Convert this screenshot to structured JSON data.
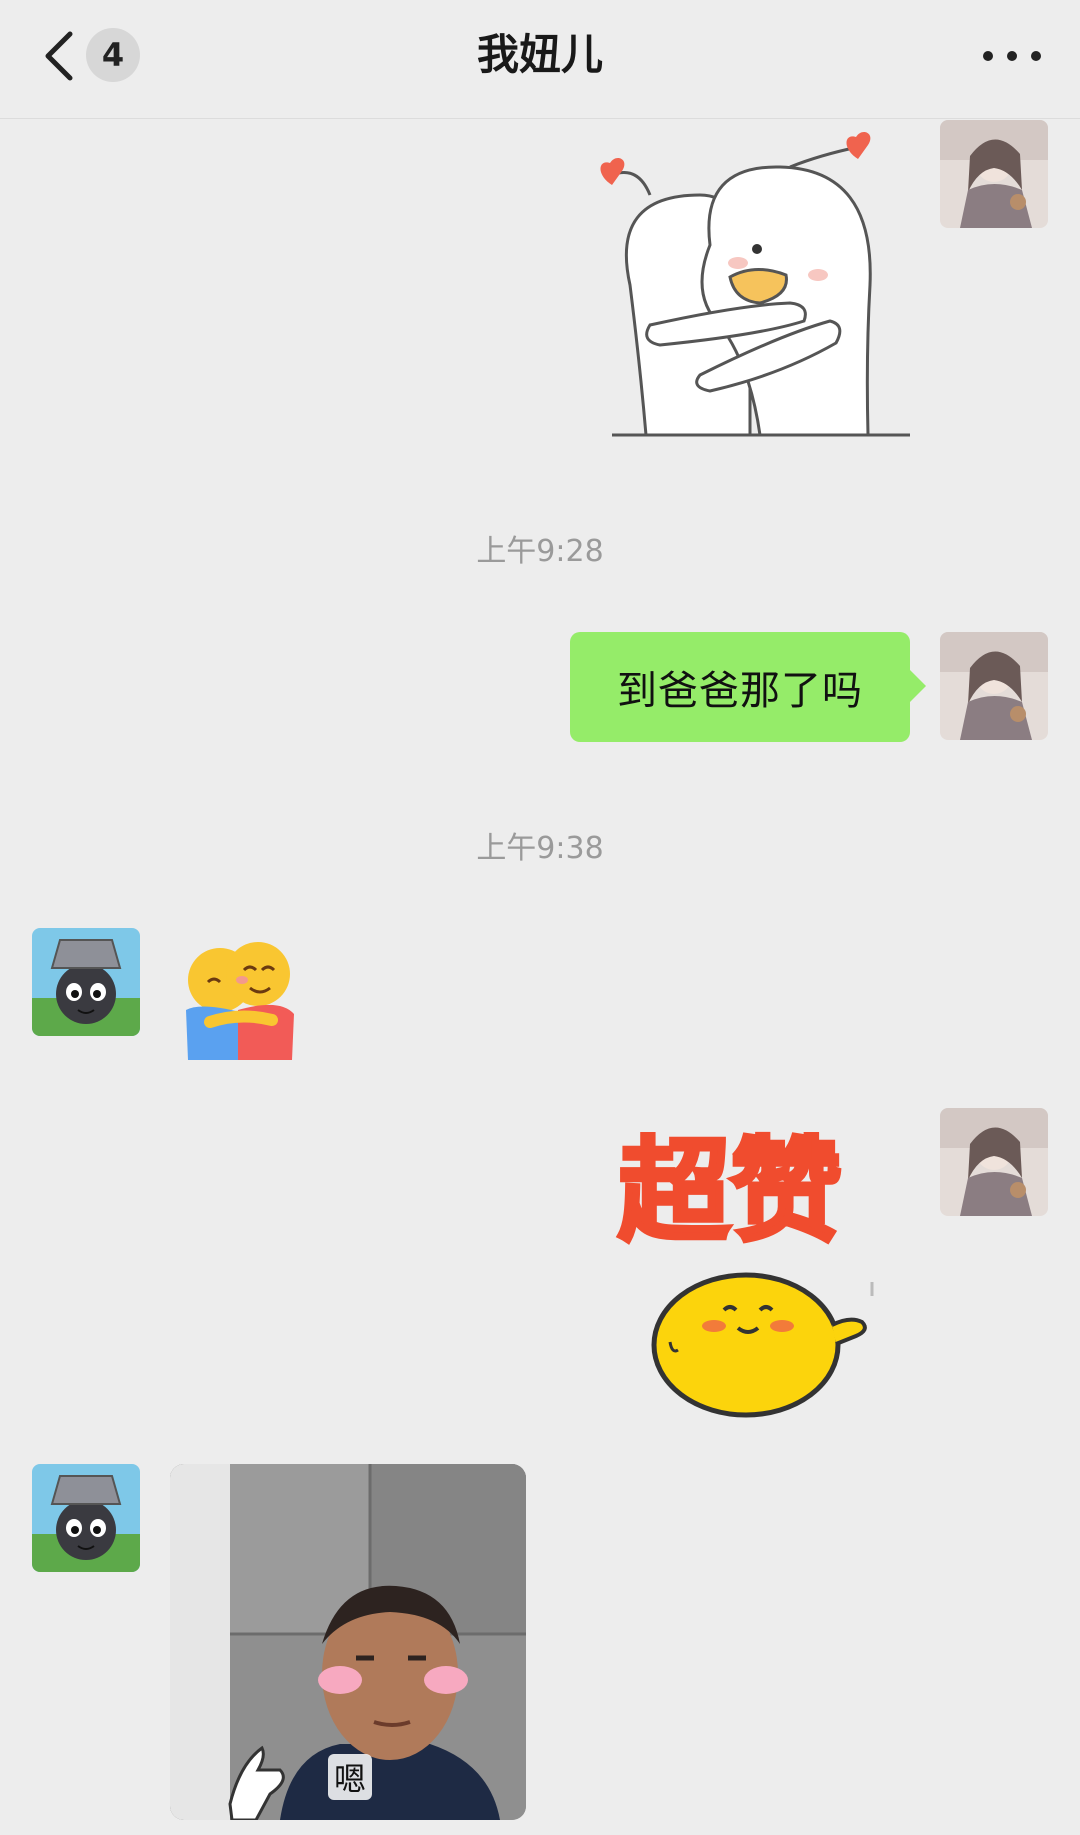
{
  "header": {
    "unread_count": "4",
    "title": "我妞儿",
    "icons": {
      "back": "chevron-left-icon",
      "more": "more-dots-icon"
    }
  },
  "messages": [
    {
      "sender": "me",
      "kind": "sticker",
      "sticker": "hugging-ducks-sticker"
    },
    {
      "kind": "timestamp",
      "text": "上午9:28"
    },
    {
      "sender": "me",
      "kind": "text",
      "text": "到爸爸那了吗"
    },
    {
      "kind": "timestamp",
      "text": "上午9:38"
    },
    {
      "sender": "other",
      "kind": "emoji",
      "emoji": "hug-emoji"
    },
    {
      "sender": "me",
      "kind": "sticker",
      "sticker": "super-like-sticker",
      "caption": "超赞"
    },
    {
      "sender": "other",
      "kind": "image",
      "caption": "嗯"
    }
  ],
  "colors": {
    "background": "#ededed",
    "my_bubble": "#95ec69",
    "timestamp_text": "#9a9a9a"
  }
}
